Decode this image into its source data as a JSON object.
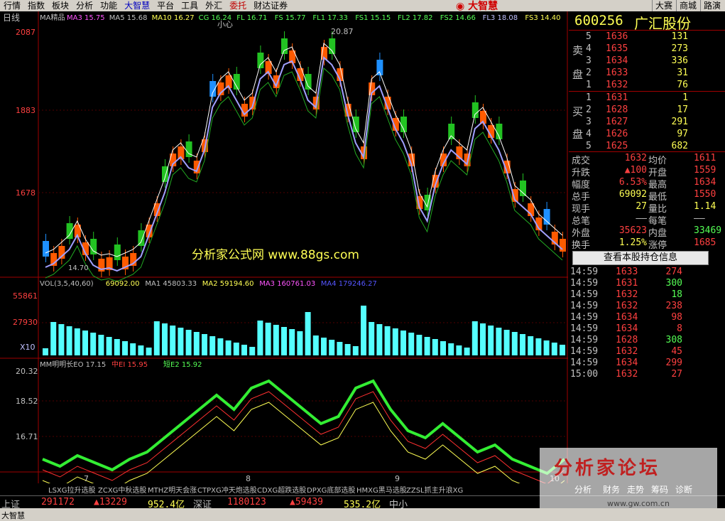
{
  "menu": {
    "items": [
      "行情",
      "指数",
      "板块",
      "分析",
      "功能",
      "大智慧",
      "平台",
      "工具",
      "外汇",
      "委托",
      "财达证券"
    ],
    "brand": "大智慧",
    "right_buttons": [
      "大赛",
      "商城",
      "路演"
    ]
  },
  "main": {
    "period": "日线",
    "ma_legend": {
      "title": "MA精品",
      "items": [
        {
          "label": "MA3",
          "value": "15.75",
          "color": "#ff55ff"
        },
        {
          "label": "MA5",
          "value": "15.68",
          "color": "#c0c0c0"
        },
        {
          "label": "MA10",
          "value": "16.27",
          "color": "#ffff54"
        },
        {
          "label": "CG",
          "value": "16.24",
          "color": "#55ff55"
        },
        {
          "label": "FL",
          "value": "16.71",
          "color": "#55ff55"
        },
        {
          "label": "FS",
          "value": "15.77",
          "color": "#55ff55"
        },
        {
          "label": "FL1",
          "value": "17.33",
          "color": "#55ff55"
        },
        {
          "label": "FS1",
          "value": "15.15",
          "color": "#55ff55"
        },
        {
          "label": "FL2",
          "value": "17.82",
          "color": "#55ff55"
        },
        {
          "label": "FS2",
          "value": "14.66",
          "color": "#55ff55"
        },
        {
          "label": "FL3",
          "value": "18.08",
          "color": "#c0c0ff"
        },
        {
          "label": "FS3",
          "value": "14.40",
          "color": "#ffff54"
        }
      ]
    },
    "price_axis": [
      "2087",
      "1883",
      "1678"
    ],
    "high_marker": "20.87",
    "low_marker": "14.70",
    "small_label": "小心",
    "watermark": "分析家公式网  www.88gs.com"
  },
  "volume": {
    "legend": [
      {
        "text": "VOL(3,5,40,60)",
        "color": "#c0c0c0"
      },
      {
        "text": "69092.00",
        "color": "#ffff54"
      },
      {
        "text": "MA1 45803.33",
        "color": "#c0c0c0"
      },
      {
        "text": "MA2 59194.60",
        "color": "#ffff54"
      },
      {
        "text": "MA3 160761.03",
        "color": "#ff55ff"
      },
      {
        "text": "MA4 179246.27",
        "color": "#5555ff"
      }
    ],
    "axis": [
      "55861",
      "27930",
      "X10"
    ]
  },
  "indicator": {
    "legend": [
      {
        "text": "MM明明长EO 17.15",
        "color": "#c0c0c0"
      },
      {
        "text": "中EI 15.95",
        "color": "#ff4040"
      },
      {
        "text": "短E2 15.92",
        "color": "#55ff55"
      }
    ],
    "axis": [
      "20.32",
      "18.52",
      "16.71"
    ],
    "x_labels": [
      "7",
      "8",
      "9",
      "10"
    ]
  },
  "formula_tabs": [
    "LSXG拉升选股",
    "ZCXG中秋选股",
    "MTHZ明天会涨",
    "CTPXG冲天炮选股",
    "CDXG超跌选股",
    "DPXG底部选股",
    "HMXG黑马选股",
    "ZZSL抓主升浪XG"
  ],
  "right_tabs": [
    "分析",
    "财务",
    "走势",
    "筹码",
    "诊断"
  ],
  "quote": {
    "code": "600256",
    "name": "广汇股份",
    "sell_label": [
      "卖",
      "盘"
    ],
    "buy_label": [
      "买",
      "盘"
    ],
    "asks": [
      {
        "lvl": "5",
        "price": "1636",
        "vol": "131"
      },
      {
        "lvl": "4",
        "price": "1635",
        "vol": "273"
      },
      {
        "lvl": "3",
        "price": "1634",
        "vol": "336"
      },
      {
        "lvl": "2",
        "price": "1633",
        "vol": "31"
      },
      {
        "lvl": "1",
        "price": "1632",
        "vol": "76"
      }
    ],
    "bids": [
      {
        "lvl": "1",
        "price": "1631",
        "vol": "1"
      },
      {
        "lvl": "2",
        "price": "1628",
        "vol": "17"
      },
      {
        "lvl": "3",
        "price": "1627",
        "vol": "291"
      },
      {
        "lvl": "4",
        "price": "1626",
        "vol": "97"
      },
      {
        "lvl": "5",
        "price": "1625",
        "vol": "682"
      }
    ],
    "stats": [
      {
        "k1": "成交",
        "v1": "1632",
        "k2": "均价",
        "v2": "1611",
        "c1": "#ff4040",
        "c2": "#ff4040"
      },
      {
        "k1": "升跌",
        "v1": "▲100",
        "k2": "开盘",
        "v2": "1559",
        "c1": "#ff4040",
        "c2": "#ff4040"
      },
      {
        "k1": "幅度",
        "v1": "6.53%",
        "k2": "最高",
        "v2": "1634",
        "c1": "#ff4040",
        "c2": "#ff4040"
      },
      {
        "k1": "总手",
        "v1": "69092",
        "k2": "最低",
        "v2": "1550",
        "c1": "#ffff54",
        "c2": "#ff4040"
      },
      {
        "k1": "现手",
        "v1": "27",
        "k2": "量比",
        "v2": "1.14",
        "c1": "#ffff54",
        "c2": "#ffff54"
      },
      {
        "k1": "总笔",
        "v1": "——",
        "k2": "每笔",
        "v2": "——",
        "c1": "#c0c0c0",
        "c2": "#c0c0c0"
      },
      {
        "k1": "外盘",
        "v1": "35623",
        "k2": "内盘",
        "v2": "33469",
        "c1": "#ff4040",
        "c2": "#55ff55"
      },
      {
        "k1": "换手",
        "v1": "1.25%",
        "k2": "涨停",
        "v2": "1685",
        "c1": "#ffff54",
        "c2": "#ff4040"
      }
    ],
    "hold_button": "查看本股持仓信息",
    "ticks": [
      {
        "t": "14:59",
        "p": "1633",
        "v": "274",
        "vc": "#ff4040"
      },
      {
        "t": "14:59",
        "p": "1631",
        "v": "300",
        "vc": "#55ff55"
      },
      {
        "t": "14:59",
        "p": "1632",
        "v": "18",
        "vc": "#55ff55"
      },
      {
        "t": "14:59",
        "p": "1632",
        "v": "238",
        "vc": "#ff4040"
      },
      {
        "t": "14:59",
        "p": "1634",
        "v": "98",
        "vc": "#ff4040"
      },
      {
        "t": "14:59",
        "p": "1634",
        "v": "8",
        "vc": "#ff4040"
      },
      {
        "t": "14:59",
        "p": "1628",
        "v": "308",
        "vc": "#55ff55"
      },
      {
        "t": "14:59",
        "p": "1632",
        "v": "45",
        "vc": "#ff4040"
      },
      {
        "t": "14:59",
        "p": "1634",
        "v": "299",
        "vc": "#ff4040"
      },
      {
        "t": "15:00",
        "p": "1632",
        "v": "27",
        "vc": "#ff4040"
      }
    ]
  },
  "index_bar": {
    "sh_label": "上证",
    "sh_index": "291172",
    "sh_change": "▲13229",
    "sh_amount": "952.4亿",
    "sz_label": "深证",
    "sz_index": "1180123",
    "sz_change": "▲59439",
    "sz_amount": "535.2亿",
    "sme": "中小"
  },
  "status": {
    "left": "大智慧"
  },
  "forum": {
    "title": "分析家论坛",
    "url": "www.gw.com.cn"
  }
}
